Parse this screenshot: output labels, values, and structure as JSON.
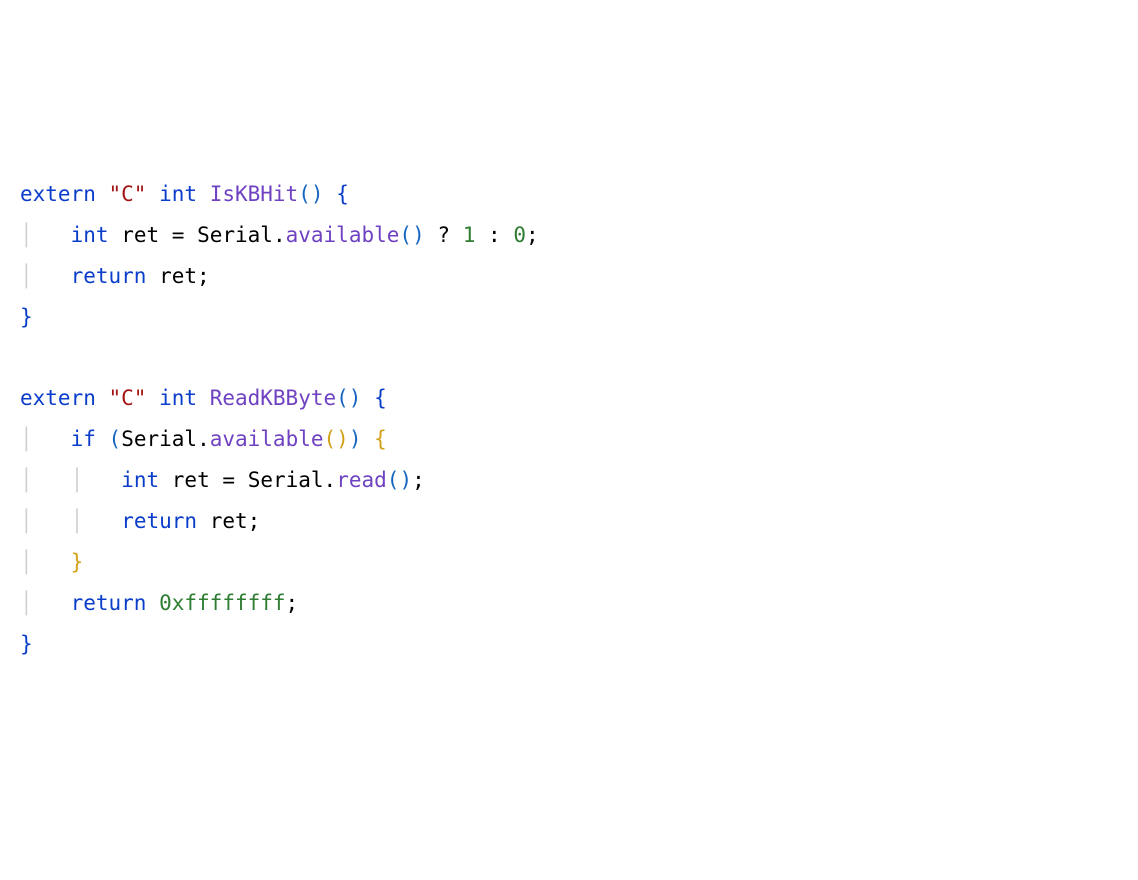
{
  "tokens": {
    "extern": "extern",
    "C": "\"C\"",
    "int": "int",
    "IsKBHit": "IsKBHit",
    "ReadKBByte": "ReadKBByte",
    "ret": "ret",
    "Serial": "Serial",
    "available": "available",
    "read": "read",
    "return": "return",
    "if": "if",
    "eq": "=",
    "q": "?",
    "colon": ":",
    "semi": ";",
    "dot": ".",
    "one": "1",
    "zero": "0",
    "hex": "0xffffffff",
    "lp": "(",
    "rp": ")",
    "lb": "{",
    "rb": "}",
    "sp": " ",
    "indent1": "    ",
    "indent2": "        ",
    "guide": "│"
  },
  "chart_data": null
}
